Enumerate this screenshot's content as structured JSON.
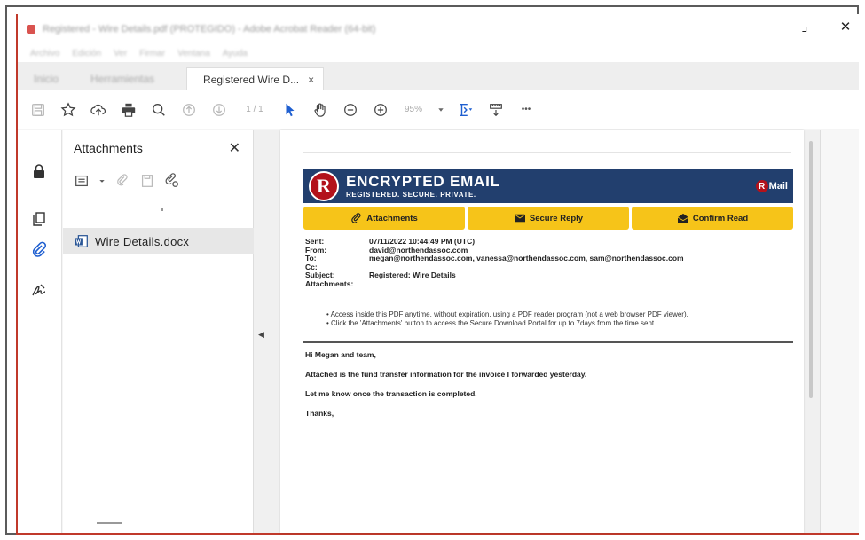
{
  "window": {
    "title": "Registered - Wire Details.pdf (PROTEGIDO) - Adobe Acrobat Reader (64-bit)",
    "minimize_glyph": "⌟",
    "close_glyph": "✕"
  },
  "menu": [
    "Archivo",
    "Edición",
    "Ver",
    "Firmar",
    "Ventana",
    "Ayuda"
  ],
  "tabs": [
    {
      "label": "Inicio"
    },
    {
      "label": "Herramientas"
    },
    {
      "label": "Registered  Wire D...",
      "active": true
    }
  ],
  "tab_close": "×",
  "toolbar": {
    "page_indicator": "1 / 1",
    "zoom": "95%",
    "more": "•••"
  },
  "attachments_panel": {
    "title": "Attachments",
    "close": "✕",
    "file_name": "Wire Details.docx"
  },
  "email": {
    "banner_title": "ENCRYPTED EMAIL",
    "banner_subtitle": "REGISTERED. SECURE. PRIVATE.",
    "logo_letter": "R",
    "rmail_label": "Mail",
    "buttons": [
      "Attachments",
      "Secure Reply",
      "Confirm Read"
    ],
    "header": [
      {
        "k": "Sent:",
        "v": "07/11/2022 10:44:49 PM (UTC)"
      },
      {
        "k": "From:",
        "v": "david@northendassoc.com"
      },
      {
        "k": "To:",
        "v": "megan@northendassoc.com, vanessa@northendassoc.com, sam@northendassoc.com"
      },
      {
        "k": "Cc:",
        "v": ""
      },
      {
        "k": "Subject:",
        "v": "Registered: Wire Details"
      },
      {
        "k": "Attachments:",
        "v": ""
      }
    ],
    "notes": [
      "• Access inside this PDF anytime, without expiration, using a PDF reader program (not a web browser PDF viewer).",
      "• Click the 'Attachments' button to access the Secure Download Portal for up to 7days from the time sent."
    ],
    "body": [
      "Hi Megan and team,",
      "Attached is the fund transfer information for the invoice I forwarded yesterday.",
      "Let me know once the transaction is completed.",
      "Thanks,"
    ]
  },
  "colors": {
    "banner": "#223f6e",
    "button_yellow": "#f6c419",
    "logo_red": "#b3121b",
    "pointer_blue": "#1f5fd0"
  }
}
